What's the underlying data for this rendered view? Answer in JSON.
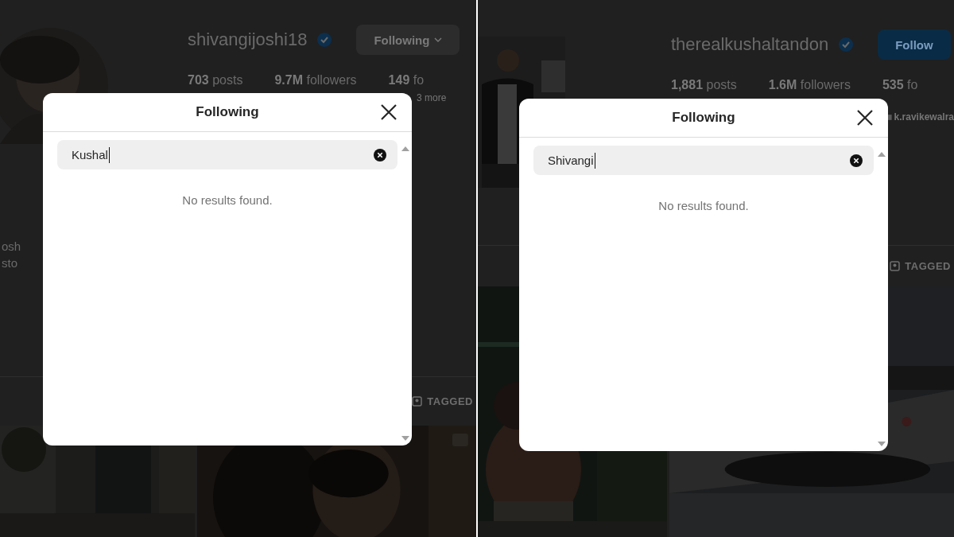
{
  "panels": [
    {
      "profile": {
        "username": "shivangijoshi18",
        "verified": true,
        "action": {
          "kind": "following",
          "label": "Following"
        },
        "stats": [
          {
            "count": "703",
            "label": "posts"
          },
          {
            "count": "9.7M",
            "label": "followers"
          },
          {
            "count": "149",
            "label": "fo"
          }
        ],
        "followed_by": "3 more",
        "highlights": [
          "osh",
          "sto"
        ],
        "tab": "TAGGED"
      },
      "dialog": {
        "title": "Following",
        "search": {
          "value": "Kushal"
        },
        "empty_text": "No results found."
      }
    },
    {
      "profile": {
        "username": "therealkushaltandon",
        "verified": true,
        "action": {
          "kind": "follow",
          "label": "Follow"
        },
        "stats": [
          {
            "count": "1,881",
            "label": "posts"
          },
          {
            "count": "1.6M",
            "label": "followers"
          },
          {
            "count": "535",
            "label": "fo"
          }
        ],
        "followed_by": "k.ravikewalra",
        "tab": "TAGGED"
      },
      "dialog": {
        "title": "Following",
        "search": {
          "value": "Shivangi"
        },
        "empty_text": "No results found."
      }
    }
  ]
}
